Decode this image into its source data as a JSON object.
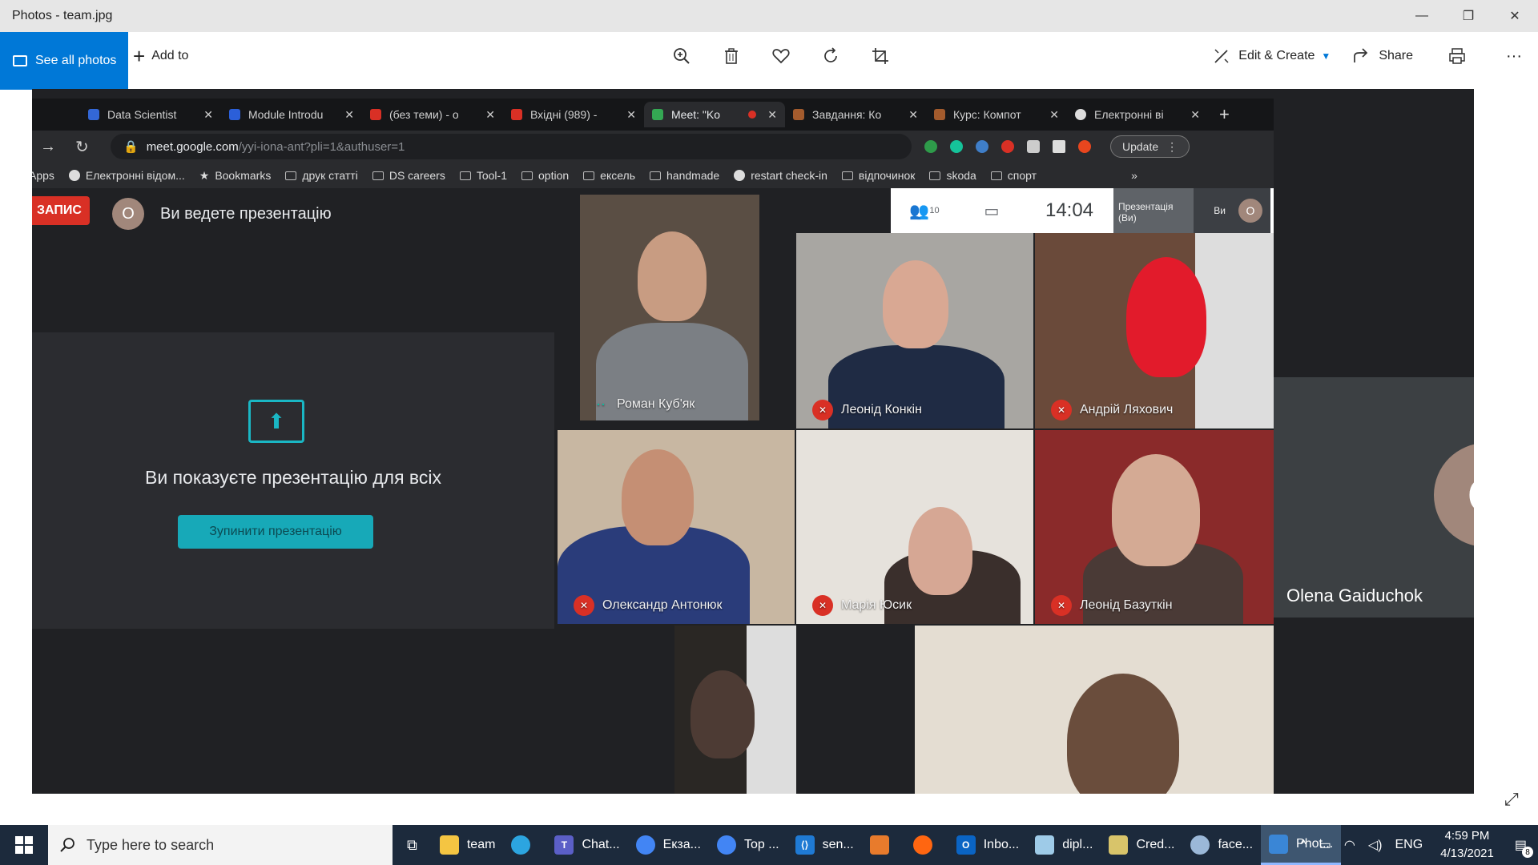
{
  "window": {
    "title": "Photos - team.jpg",
    "minimize": "—",
    "restore": "❐",
    "close": "✕"
  },
  "toolbar": {
    "see_all": "See all photos",
    "add_to": "Add to",
    "edit_create": "Edit & Create",
    "share": "Share",
    "more": "···",
    "icons": [
      "zoom-icon",
      "delete-icon",
      "heart-icon",
      "rotate-icon",
      "crop-icon",
      "print-icon"
    ]
  },
  "browser": {
    "tabs": [
      {
        "label": "Data Scientist",
        "color": "#3367d6"
      },
      {
        "label": "Module Introdu",
        "color": "#2b5fd9"
      },
      {
        "label": "(без теми) - о",
        "color": "#d93025"
      },
      {
        "label": "Вхідні (989) -",
        "color": "#d93025"
      },
      {
        "label": "Meet: \"Ko",
        "color": "#34a853"
      },
      {
        "label": "Завдання: Ко",
        "color": "#a35b2d"
      },
      {
        "label": "Курс: Компот",
        "color": "#a35b2d"
      },
      {
        "label": "Електронні ві",
        "color": "#dddddd"
      }
    ],
    "new_tab": "+",
    "url_host": "meet.google.com",
    "url_path": "/yyi-iona-ant?pli=1&authuser=1",
    "update_label": "Update",
    "bookmarks": [
      "Apps",
      "Електронні відом...",
      "Bookmarks",
      "друк статті",
      "DS careers",
      "Tool-1",
      "option",
      "ексель",
      "handmade",
      "restart check-in",
      "відпочинок",
      "skoda",
      "спорт"
    ]
  },
  "meet": {
    "record_label": "ЗАПИС",
    "self_initial": "O",
    "presenting_label": "Ви ведете презентацію",
    "present_all_text": "Ви показуєте презентацію для всіх",
    "stop_button": "Зупинити презентацію",
    "participants_count": "10",
    "time": "14:04",
    "mini_tile_label": "Презентація (Ви)",
    "mini_self_label": "Ви",
    "tiles": [
      {
        "name": "Роман Куб'як",
        "muted": false
      },
      {
        "name": "Леонід Конкін",
        "muted": true
      },
      {
        "name": "Андрій Ляхович",
        "muted": true
      },
      {
        "name": "Олександр Антонюк",
        "muted": true
      },
      {
        "name": "Марія Юсик",
        "muted": true
      },
      {
        "name": "Леонід Базуткін",
        "muted": true
      }
    ],
    "side_tile_name": "Olena Gaiduchok",
    "side_tile_initial": "O"
  },
  "taskbar": {
    "search_placeholder": "Type here to search",
    "items": [
      {
        "label": "team",
        "color": "#f4c542"
      },
      {
        "label": "",
        "color": "#2ca5e0"
      },
      {
        "label": "Chat...",
        "color": "#5b5fc7"
      },
      {
        "label": "Екза...",
        "color": "#4285f4"
      },
      {
        "label": "Top ...",
        "color": "#4285f4"
      },
      {
        "label": "sen...",
        "color": "#1f7ad4"
      },
      {
        "label": "",
        "color": "#e87b2c"
      },
      {
        "label": "",
        "color": "#ff6611"
      },
      {
        "label": "Inbo...",
        "color": "#0a64c4"
      },
      {
        "label": "dipl...",
        "color": "#9ecbe8"
      },
      {
        "label": "Cred...",
        "color": "#d8c46a"
      },
      {
        "label": "face...",
        "color": "#9bb8d8"
      },
      {
        "label": "Phot...",
        "color": "#3a86d6"
      }
    ],
    "language": "ENG",
    "time": "4:59 PM",
    "date": "4/13/2021",
    "notifications": "8"
  }
}
